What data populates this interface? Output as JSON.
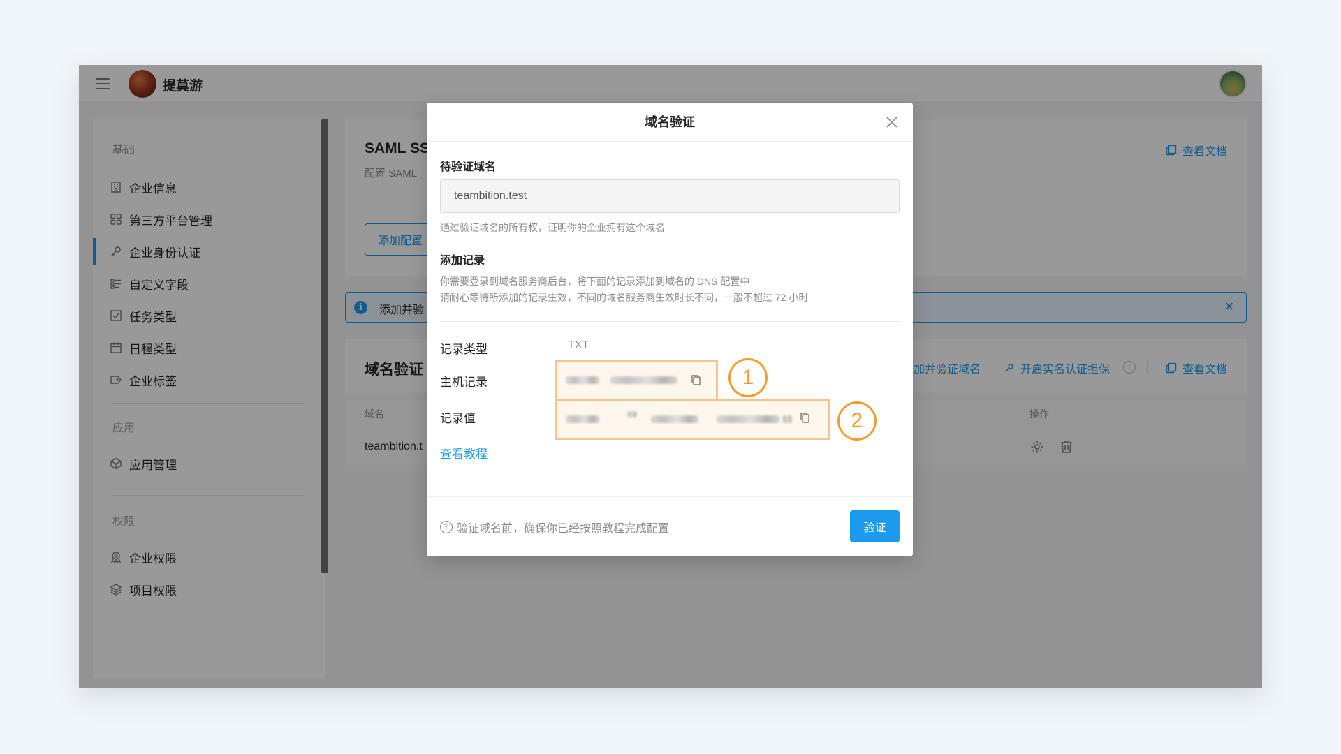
{
  "topbar": {
    "org_name": "提莫游"
  },
  "sidebar": {
    "groups": [
      {
        "label": "基础"
      },
      {
        "label": "应用"
      },
      {
        "label": "权限"
      }
    ],
    "items": [
      {
        "label": "企业信息",
        "icon": "building-icon"
      },
      {
        "label": "第三方平台管理",
        "icon": "grid-icon"
      },
      {
        "label": "企业身份认证",
        "icon": "key-icon",
        "active": true
      },
      {
        "label": "自定义字段",
        "icon": "fields-icon"
      },
      {
        "label": "任务类型",
        "icon": "checkbox-icon"
      },
      {
        "label": "日程类型",
        "icon": "calendar-icon"
      },
      {
        "label": "企业标签",
        "icon": "tag-icon"
      },
      {
        "label": "应用管理",
        "icon": "box-icon"
      },
      {
        "label": "企业权限",
        "icon": "badge-icon"
      },
      {
        "label": "项目权限",
        "icon": "layers-icon"
      }
    ]
  },
  "main": {
    "saml_card": {
      "title": "SAML SS",
      "subtitle": "配置 SAML",
      "doc_link": "查看文档"
    },
    "add_config_button": "添加配置",
    "info_bar": {
      "text": "添加并验"
    },
    "domain_card": {
      "title": "域名验证",
      "add_verify_link": "添加并验证域名",
      "realname_link": "开启实名认证担保",
      "doc_link": "查看文档",
      "columns": {
        "domain": "域名",
        "ops": "操作"
      },
      "rows": [
        {
          "domain": "teambition.t"
        }
      ]
    }
  },
  "modal": {
    "title": "域名验证",
    "pending_label": "待验证域名",
    "domain_value": "teambition.test",
    "domain_hint": "通过验证域名的所有权，证明你的企业拥有这个域名",
    "add_record_label": "添加记录",
    "add_record_hint_1": "你需要登录到域名服务商后台，将下面的记录添加到域名的 DNS 配置中",
    "add_record_hint_2": "请耐心等待所添加的记录生效，不同的域名服务商生效时长不同，一般不超过 72 小时",
    "record_type_label": "记录类型",
    "record_type_value": "TXT",
    "host_label": "主机记录",
    "value_label": "记录值",
    "badge_1": "1",
    "badge_2": "2",
    "tutorial_link": "查看教程",
    "footer_hint": "验证域名前，确保你已经按照教程完成配置",
    "verify_button": "验证"
  },
  "colors": {
    "accent": "#1b9aee",
    "highlight_border": "#f6c58f",
    "badge": "#f39c32"
  }
}
